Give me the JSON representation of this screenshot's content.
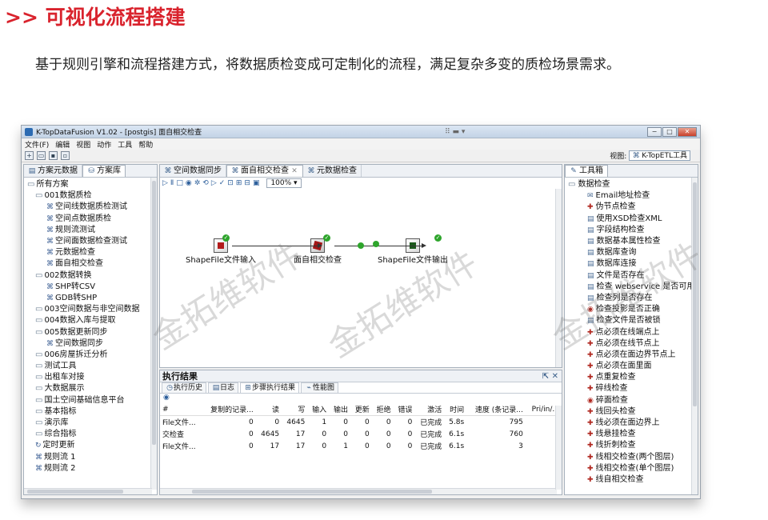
{
  "page": {
    "title": ">> 可视化流程搭建",
    "description": "基于规则引擎和流程搭建方式，将数据质检变成可定制化的流程，满足复杂多变的质检场景需求。"
  },
  "window": {
    "title": "K-TopDataFusion V1.02 - [postgis] 面自相交检查",
    "grip": "⠿ ▬ ▾",
    "minimize": "−",
    "maximize": "□",
    "close": "✕"
  },
  "menu": [
    "文件(F)",
    "编辑",
    "视图",
    "动作",
    "工具",
    "帮助"
  ],
  "toolbar": {
    "icons": [
      "new-icon",
      "open-icon",
      "save-icon",
      "save-as-icon"
    ],
    "view_label": "视图:",
    "view_button": "K-TopETL工具"
  },
  "left_panel": {
    "tabs": [
      "方案元数据",
      "方案库"
    ],
    "tree": [
      {
        "label": "所有方案",
        "level": 0,
        "type": "folder"
      },
      {
        "label": "001数据质检",
        "level": 1,
        "type": "folder"
      },
      {
        "label": "空间线数据质检测试",
        "level": 2,
        "type": "flow"
      },
      {
        "label": "空间点数据质检",
        "level": 2,
        "type": "flow"
      },
      {
        "label": "规则流测试",
        "level": 2,
        "type": "flow"
      },
      {
        "label": "空间面数据检查测试",
        "level": 2,
        "type": "flow"
      },
      {
        "label": "元数据检查",
        "level": 2,
        "type": "flow"
      },
      {
        "label": "面自相交检查",
        "level": 2,
        "type": "flow"
      },
      {
        "label": "002数据转换",
        "level": 1,
        "type": "folder"
      },
      {
        "label": "SHP转CSV",
        "level": 2,
        "type": "flow"
      },
      {
        "label": "GDB转SHP",
        "level": 2,
        "type": "flow"
      },
      {
        "label": "003空间数据与非空间数据",
        "level": 1,
        "type": "folder"
      },
      {
        "label": "004数据入库与提取",
        "level": 1,
        "type": "folder"
      },
      {
        "label": "005数据更新同步",
        "level": 1,
        "type": "folder"
      },
      {
        "label": "空间数据同步",
        "level": 2,
        "type": "flow"
      },
      {
        "label": "006房屋拆迁分析",
        "level": 1,
        "type": "folder"
      },
      {
        "label": "测试工具",
        "level": 1,
        "type": "folder"
      },
      {
        "label": "出租车对接",
        "level": 1,
        "type": "folder"
      },
      {
        "label": "大数据展示",
        "level": 1,
        "type": "folder"
      },
      {
        "label": "国土空间基础信息平台",
        "level": 1,
        "type": "folder"
      },
      {
        "label": "基本指标",
        "level": 1,
        "type": "folder"
      },
      {
        "label": "演示库",
        "level": 1,
        "type": "folder"
      },
      {
        "label": "综合指标",
        "level": 1,
        "type": "folder"
      },
      {
        "label": "定时更新",
        "level": 1,
        "type": "schedule"
      },
      {
        "label": "规则流 1",
        "level": 1,
        "type": "flow"
      },
      {
        "label": "规则流 2",
        "level": 1,
        "type": "flow"
      }
    ]
  },
  "editor": {
    "tabs": [
      "空间数据同步",
      "面自相交检查",
      "元数据检查"
    ],
    "zoom": "100%",
    "steps": [
      {
        "label": "ShapeFile文件输入"
      },
      {
        "label": "面自相交检查"
      },
      {
        "label": "ShapeFile文件输出"
      }
    ],
    "watermark": "金拓维软件"
  },
  "results": {
    "title": "执行结果",
    "tabs": [
      "执行历史",
      "日志",
      "步骤执行结果",
      "性能图"
    ],
    "columns": [
      "#",
      "复制的记录...",
      "读",
      "写",
      "输入",
      "输出",
      "更新",
      "拒绝",
      "错误",
      "激活",
      "时间",
      "速度 (条记录...",
      "Pri/in/..."
    ],
    "rows": [
      [
        "File文件...",
        "0",
        "0",
        "4645",
        "1",
        "0",
        "0",
        "0",
        "0",
        "已完成",
        "5.8s",
        "795",
        "-"
      ],
      [
        "交检查",
        "0",
        "4645",
        "17",
        "0",
        "0",
        "0",
        "0",
        "0",
        "已完成",
        "6.1s",
        "760",
        "-"
      ],
      [
        "File文件...",
        "0",
        "17",
        "17",
        "0",
        "1",
        "0",
        "0",
        "0",
        "已完成",
        "6.1s",
        "3",
        "-"
      ]
    ]
  },
  "tools_panel": {
    "title": "工具箱",
    "category": "数据检查",
    "items": [
      "Email地址检查",
      "伪节点检查",
      "使用XSD检查XML",
      "字段结构检查",
      "数据基本属性检查",
      "数据库查询",
      "数据库连接",
      "文件是否存在",
      "检查 webservice 是否可用",
      "检查列是否存在",
      "检查投影是否正确",
      "检查文件是否被锁",
      "点必须在线端点上",
      "点必须在线节点上",
      "点必须在面边界节点上",
      "点必须在面里面",
      "点重复检查",
      "碎线检查",
      "碎面检查",
      "线回头检查",
      "线必须在面边界上",
      "线悬挂检查",
      "线折刺检查",
      "线相交检查(两个图层)",
      "线相交检查(单个图层)",
      "线自相交检查"
    ]
  }
}
